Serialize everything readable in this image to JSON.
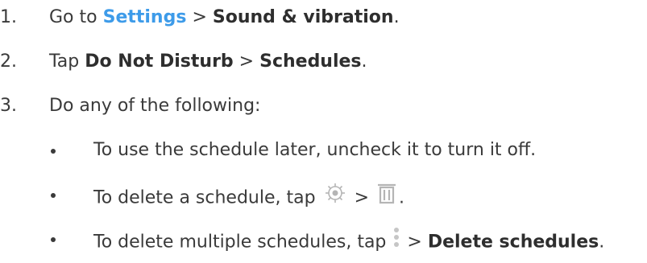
{
  "steps": [
    {
      "number": "1.",
      "parts": {
        "pre": "Go to ",
        "link": "Settings",
        "sep": " > ",
        "bold": "Sound & vibration",
        "post": "."
      }
    },
    {
      "number": "2.",
      "parts": {
        "pre": "Tap ",
        "bold1": "Do Not Disturb",
        "sep": " > ",
        "bold2": "Schedules",
        "post": "."
      }
    },
    {
      "number": "3.",
      "text": "Do any of the following:"
    }
  ],
  "bullets": [
    {
      "text": "To use the schedule later, uncheck it to turn it off."
    },
    {
      "pre": "To delete a schedule, tap ",
      "icon1": "gear-icon",
      "sep": " > ",
      "icon2": "trash-icon",
      "post": "."
    },
    {
      "pre": "To delete multiple schedules, tap ",
      "icon": "more-vertical-icon",
      "sep": " > ",
      "bold": "Delete schedules",
      "post": "."
    }
  ],
  "colors": {
    "link": "#3d9be9",
    "text": "#3a3a3a",
    "icon": "#b5b5b5"
  }
}
